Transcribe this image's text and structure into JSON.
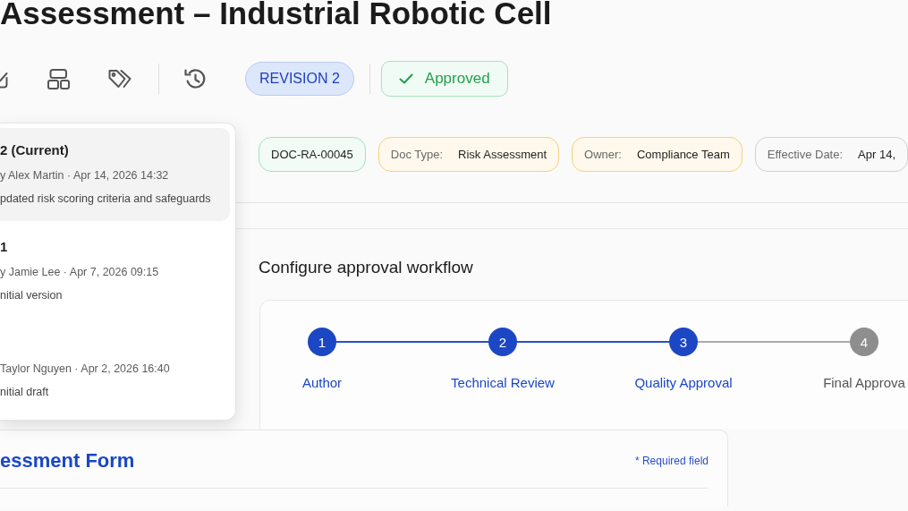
{
  "page": {
    "title": "Assessment – Industrial Robotic Cell"
  },
  "toolbar": {
    "revision": "REVISION 2",
    "status": "Approved"
  },
  "version_history": [
    {
      "title": "2 (Current)",
      "meta": "y Alex Martin · Apr 14, 2026 14:32",
      "note": "pdated risk scoring criteria and safeguards",
      "selected": true
    },
    {
      "title": "1",
      "meta": "y Jamie Lee · Apr 7, 2026 09:15",
      "note": "nitial version",
      "selected": false
    },
    {
      "meta": "Taylor Nguyen · Apr 2, 2026 16:40",
      "note": "nitial draft",
      "selected": false
    }
  ],
  "document_chips": [
    {
      "value": "DOC-RA-00045",
      "color": "#9fe3c0"
    },
    {
      "label": "Doc Type:",
      "value": "Risk Assessment",
      "color": "#f6d27a"
    },
    {
      "label": "Owner:",
      "value": "Compliance Team",
      "color": "#f6d27a"
    },
    {
      "label": "Effective Date:",
      "value": "Apr 14,",
      "color": "#d2d2d2"
    }
  ],
  "workflow": {
    "heading": "Configure approval workflow",
    "steps": [
      {
        "number": "1",
        "label": "Author",
        "active": true
      },
      {
        "number": "2",
        "label": "Technical Review",
        "active": true
      },
      {
        "number": "3",
        "label": "Quality Approval",
        "active": true
      },
      {
        "number": "4",
        "label": "Final Approva",
        "active": false
      }
    ]
  },
  "form": {
    "title": "essment Form",
    "required_note": "* Required field"
  }
}
